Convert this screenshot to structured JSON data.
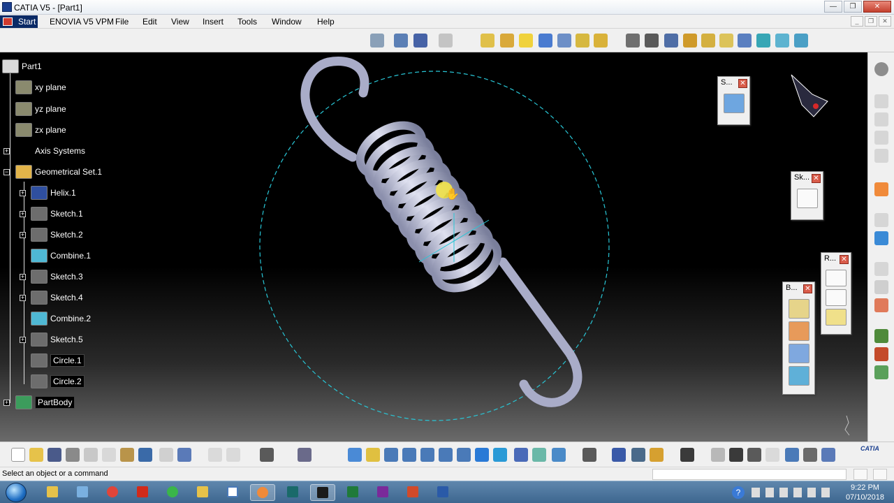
{
  "window": {
    "title": "CATIA V5 - [Part1]",
    "minimize": "—",
    "restore": "❐",
    "close": "✕"
  },
  "menu": {
    "start": "Start",
    "items": [
      "ENOVIA V5 VPM",
      "File",
      "Edit",
      "View",
      "Insert",
      "Tools",
      "Window",
      "Help"
    ]
  },
  "tree": {
    "root": "Part1",
    "items": [
      {
        "label": "xy plane",
        "icon": "plane-icon"
      },
      {
        "label": "yz plane",
        "icon": "plane-icon"
      },
      {
        "label": "zx plane",
        "icon": "plane-icon"
      },
      {
        "label": "Axis Systems",
        "icon": "axis-system-icon"
      },
      {
        "label": "Geometrical Set.1",
        "icon": "geometrical-set-icon"
      },
      {
        "label": "Helix.1",
        "icon": "helix-icon"
      },
      {
        "label": "Sketch.1",
        "icon": "sketch-icon"
      },
      {
        "label": "Sketch.2",
        "icon": "sketch-icon"
      },
      {
        "label": "Combine.1",
        "icon": "combine-icon"
      },
      {
        "label": "Sketch.3",
        "icon": "sketch-icon"
      },
      {
        "label": "Sketch.4",
        "icon": "sketch-icon"
      },
      {
        "label": "Combine.2",
        "icon": "combine-icon"
      },
      {
        "label": "Sketch.5",
        "icon": "sketch-icon"
      },
      {
        "label": "Circle.1",
        "icon": "circle-icon"
      },
      {
        "label": "Circle.2",
        "icon": "circle-icon"
      },
      {
        "label": "PartBody",
        "icon": "part-body-icon"
      }
    ]
  },
  "floating_toolbars": [
    {
      "title": "S...",
      "icon": "eraser-icon"
    },
    {
      "title": "Sk...",
      "icon": "sketch-tool-icon"
    },
    {
      "title": "R...",
      "icon": "reference-elements-icon"
    },
    {
      "title": "B...",
      "icon": "boolean-operations-icon"
    }
  ],
  "status": {
    "prompt": "Select an object or a command"
  },
  "taskbar": {
    "time": "9:22 PM",
    "date": "07/10/2018"
  },
  "brand": {
    "logo": "CATIA"
  },
  "colors": {
    "accent": "#0a2a66",
    "selection": "#28c6d6",
    "spring": "#b9bdd6"
  }
}
